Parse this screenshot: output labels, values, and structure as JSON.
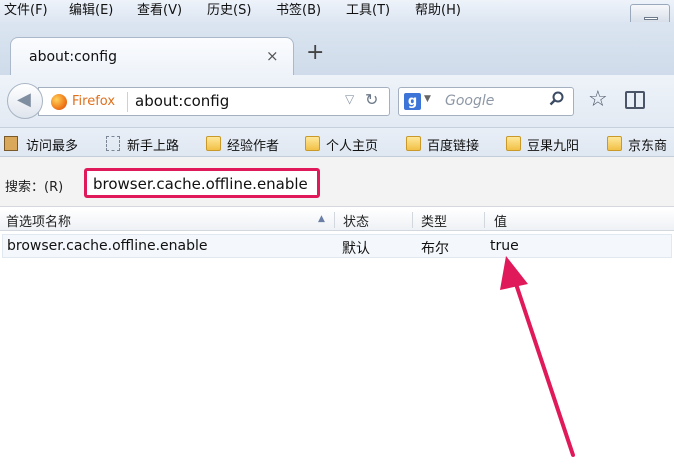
{
  "menu": [
    "文件(F)",
    "编辑(E)",
    "查看(V)",
    "历史(S)",
    "书签(B)",
    "工具(T)",
    "帮助(H)"
  ],
  "tab": {
    "title": "about:config",
    "close": "×",
    "new_tab": "+"
  },
  "nav": {
    "identity_label": "Firefox",
    "url": "about:config",
    "search_placeholder": "Google",
    "search_engine_letter": "g"
  },
  "bookmarks": [
    {
      "label": "访问最多",
      "icon": "book-icon"
    },
    {
      "label": "新手上路",
      "icon": "page-icon"
    },
    {
      "label": "经验作者",
      "icon": "folder-icon"
    },
    {
      "label": "个人主页",
      "icon": "folder-icon"
    },
    {
      "label": "百度链接",
      "icon": "folder-icon"
    },
    {
      "label": "豆果九阳",
      "icon": "folder-icon"
    },
    {
      "label": "京东商",
      "icon": "folder-icon"
    }
  ],
  "filter": {
    "label": "搜索：(R)",
    "value": "browser.cache.offline.enable"
  },
  "table": {
    "headers": [
      "首选项名称",
      "状态",
      "类型",
      "值"
    ],
    "rows": [
      {
        "name": "browser.cache.offline.enable",
        "status": "默认",
        "type": "布尔",
        "value": "true"
      }
    ]
  },
  "colors": {
    "highlight": "#e0195a",
    "firefox_orange": "#e0701c"
  }
}
